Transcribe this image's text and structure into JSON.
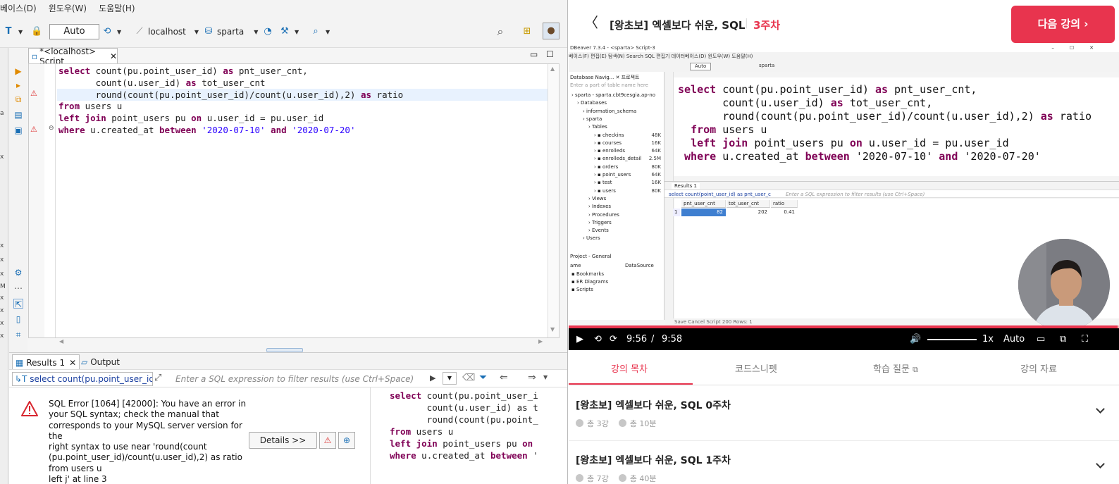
{
  "ide": {
    "menu": [
      "베이스(D)",
      "윈도우(W)",
      "도움말(H)"
    ],
    "toolbar": {
      "auto": "Auto",
      "connection": "localhost",
      "schema": "sparta"
    },
    "editor_tab": "*<localhost> Script",
    "code_lines": [
      [
        [
          "kw",
          "select"
        ],
        [
          "fn",
          " count(pu.point_user_id) "
        ],
        [
          "kw",
          "as"
        ],
        [
          "fn",
          " pnt_user_cnt,"
        ]
      ],
      [
        [
          "fn",
          "       count(u.user_id) "
        ],
        [
          "kw",
          "as"
        ],
        [
          "fn",
          " tot_user_cnt"
        ]
      ],
      [
        [
          "fn",
          "       round(count(pu.point_user_id)/count(u.user_id),2) "
        ],
        [
          "kw",
          "as"
        ],
        [
          "fn",
          " ratio"
        ]
      ],
      [
        [
          "kw",
          "from"
        ],
        [
          "fn",
          " users u"
        ]
      ],
      [
        [
          "kw",
          "left join"
        ],
        [
          "fn",
          " point_users pu "
        ],
        [
          "kw",
          "on"
        ],
        [
          "fn",
          " u.user_id = pu.user_id"
        ]
      ],
      [
        [
          "kw",
          "where"
        ],
        [
          "fn",
          " u.created_at "
        ],
        [
          "kw",
          "between"
        ],
        [
          "fn",
          " "
        ],
        [
          "str",
          "'2020-07-10'"
        ],
        [
          "fn",
          " "
        ],
        [
          "kw",
          "and"
        ],
        [
          "fn",
          " "
        ],
        [
          "str",
          "'2020-07-20'"
        ]
      ]
    ],
    "results_tab": "Results 1",
    "output_tab": "Output",
    "filter_query": "select count(pu.point_user_id) a",
    "filter_placeholder": "Enter a SQL expression to filter results (use Ctrl+Space)",
    "error_lines": [
      "SQL Error [1064] [42000]: You have an error in",
      "your SQL syntax; check the manual that",
      "corresponds to your MySQL server version for the",
      "right syntax to use near 'round(count",
      "(pu.point_user_id)/count(u.user_id),2) as ratio",
      "from users u",
      "left j' at line 3"
    ],
    "details_button": "Details >>",
    "mini_code": [
      [
        [
          "kw",
          "select"
        ],
        [
          "fn",
          " count(pu.point_user_i"
        ]
      ],
      [
        [
          "fn",
          "       count(u.user_id) as t"
        ]
      ],
      [
        [
          "fn",
          "       round(count(pu.point_"
        ]
      ],
      [
        [
          "kw",
          "from"
        ],
        [
          "fn",
          " users u"
        ]
      ],
      [
        [
          "kw",
          "left join"
        ],
        [
          "fn",
          " point_users pu "
        ],
        [
          "kw",
          "on"
        ]
      ],
      [
        [
          "kw",
          "where"
        ],
        [
          "fn",
          " u.created_at "
        ],
        [
          "kw",
          "between"
        ],
        [
          "fn",
          " '"
        ]
      ]
    ]
  },
  "course": {
    "title": "[왕초보] 엑셀보다 쉬운, SQL",
    "week": "3주차",
    "next_button": "다음 강의 ›"
  },
  "video": {
    "app_title": "DBeaver 7.3.4 - <sparta> Script-3",
    "menu": "베이스(F) 편집(E) 탐색(N) Search SQL 편집기 데이터베이스(D) 윈도우(W) 도움말(H)",
    "nav_header": "Database Navig... ✕  프로젝트",
    "nav_filter": "Enter a part of table name here",
    "nav_items": [
      {
        "label": "sparta  - sparta.cbt9cesgia.ap-no",
        "indent": 0
      },
      {
        "label": "Databases",
        "indent": 1
      },
      {
        "label": "information_schema",
        "indent": 2
      },
      {
        "label": "sparta",
        "indent": 2
      },
      {
        "label": "Tables",
        "indent": 3
      },
      {
        "label": "checkins",
        "indent": 4,
        "size": "48K"
      },
      {
        "label": "courses",
        "indent": 4,
        "size": "16K"
      },
      {
        "label": "enrolleds",
        "indent": 4,
        "size": "64K"
      },
      {
        "label": "enrolleds_detail",
        "indent": 4,
        "size": "2.5M"
      },
      {
        "label": "orders",
        "indent": 4,
        "size": "80K"
      },
      {
        "label": "point_users",
        "indent": 4,
        "size": "64K"
      },
      {
        "label": "test",
        "indent": 4,
        "size": "16K"
      },
      {
        "label": "users",
        "indent": 4,
        "size": "80K"
      },
      {
        "label": "Views",
        "indent": 3
      },
      {
        "label": "Indexes",
        "indent": 3
      },
      {
        "label": "Procedures",
        "indent": 3
      },
      {
        "label": "Triggers",
        "indent": 3
      },
      {
        "label": "Events",
        "indent": 3
      },
      {
        "label": "Users",
        "indent": 2
      }
    ],
    "project_header": "Project - General",
    "project_cols": [
      "ame",
      "DataSource"
    ],
    "project_items": [
      "Bookmarks",
      "ER Diagrams",
      "Scripts"
    ],
    "code_lines": [
      "select count(pu.point_user_id) as pnt_user_cnt,",
      "       count(u.user_id) as tot_user_cnt,",
      "       round(count(pu.point_user_id)/count(u.user_id),2) as ratio",
      "  from users u",
      "  left join point_users pu on u.user_id = pu.user_id",
      " where u.created_at between '2020-07-10' and '2020-07-20'"
    ],
    "results_tab": "Results 1",
    "filter_query": "select count(point_user_id) as pnt_user_c",
    "filter_placeholder": "Enter a SQL expression to filter results (use Ctrl+Space)",
    "grid_headers": [
      "pnt_user_cnt",
      "tot_user_cnt",
      "ratio"
    ],
    "grid_row": [
      "1",
      "82",
      "202",
      "0.41"
    ],
    "status": "Save  Cancel  Script   200   Rows: 1",
    "time_current": "9:56",
    "time_sep": "/",
    "time_total": "9:58",
    "progress_percent": 99.7,
    "speed": "1x",
    "quality": "Auto"
  },
  "tabs": [
    "강의 목차",
    "코드스니펫",
    "학습 질문",
    "강의 자료"
  ],
  "chapters": [
    {
      "title": "[왕초보] 엑셀보다 쉬운, SQL 0주차",
      "count": "총 3강",
      "duration": "총 10분"
    },
    {
      "title": "[왕초보] 엑셀보다 쉬운, SQL 1주차",
      "count": "총 7강",
      "duration": "총 40분"
    }
  ],
  "colors": {
    "accent": "#e8344e",
    "keyword": "#7f0055",
    "string": "#2a00ff"
  }
}
